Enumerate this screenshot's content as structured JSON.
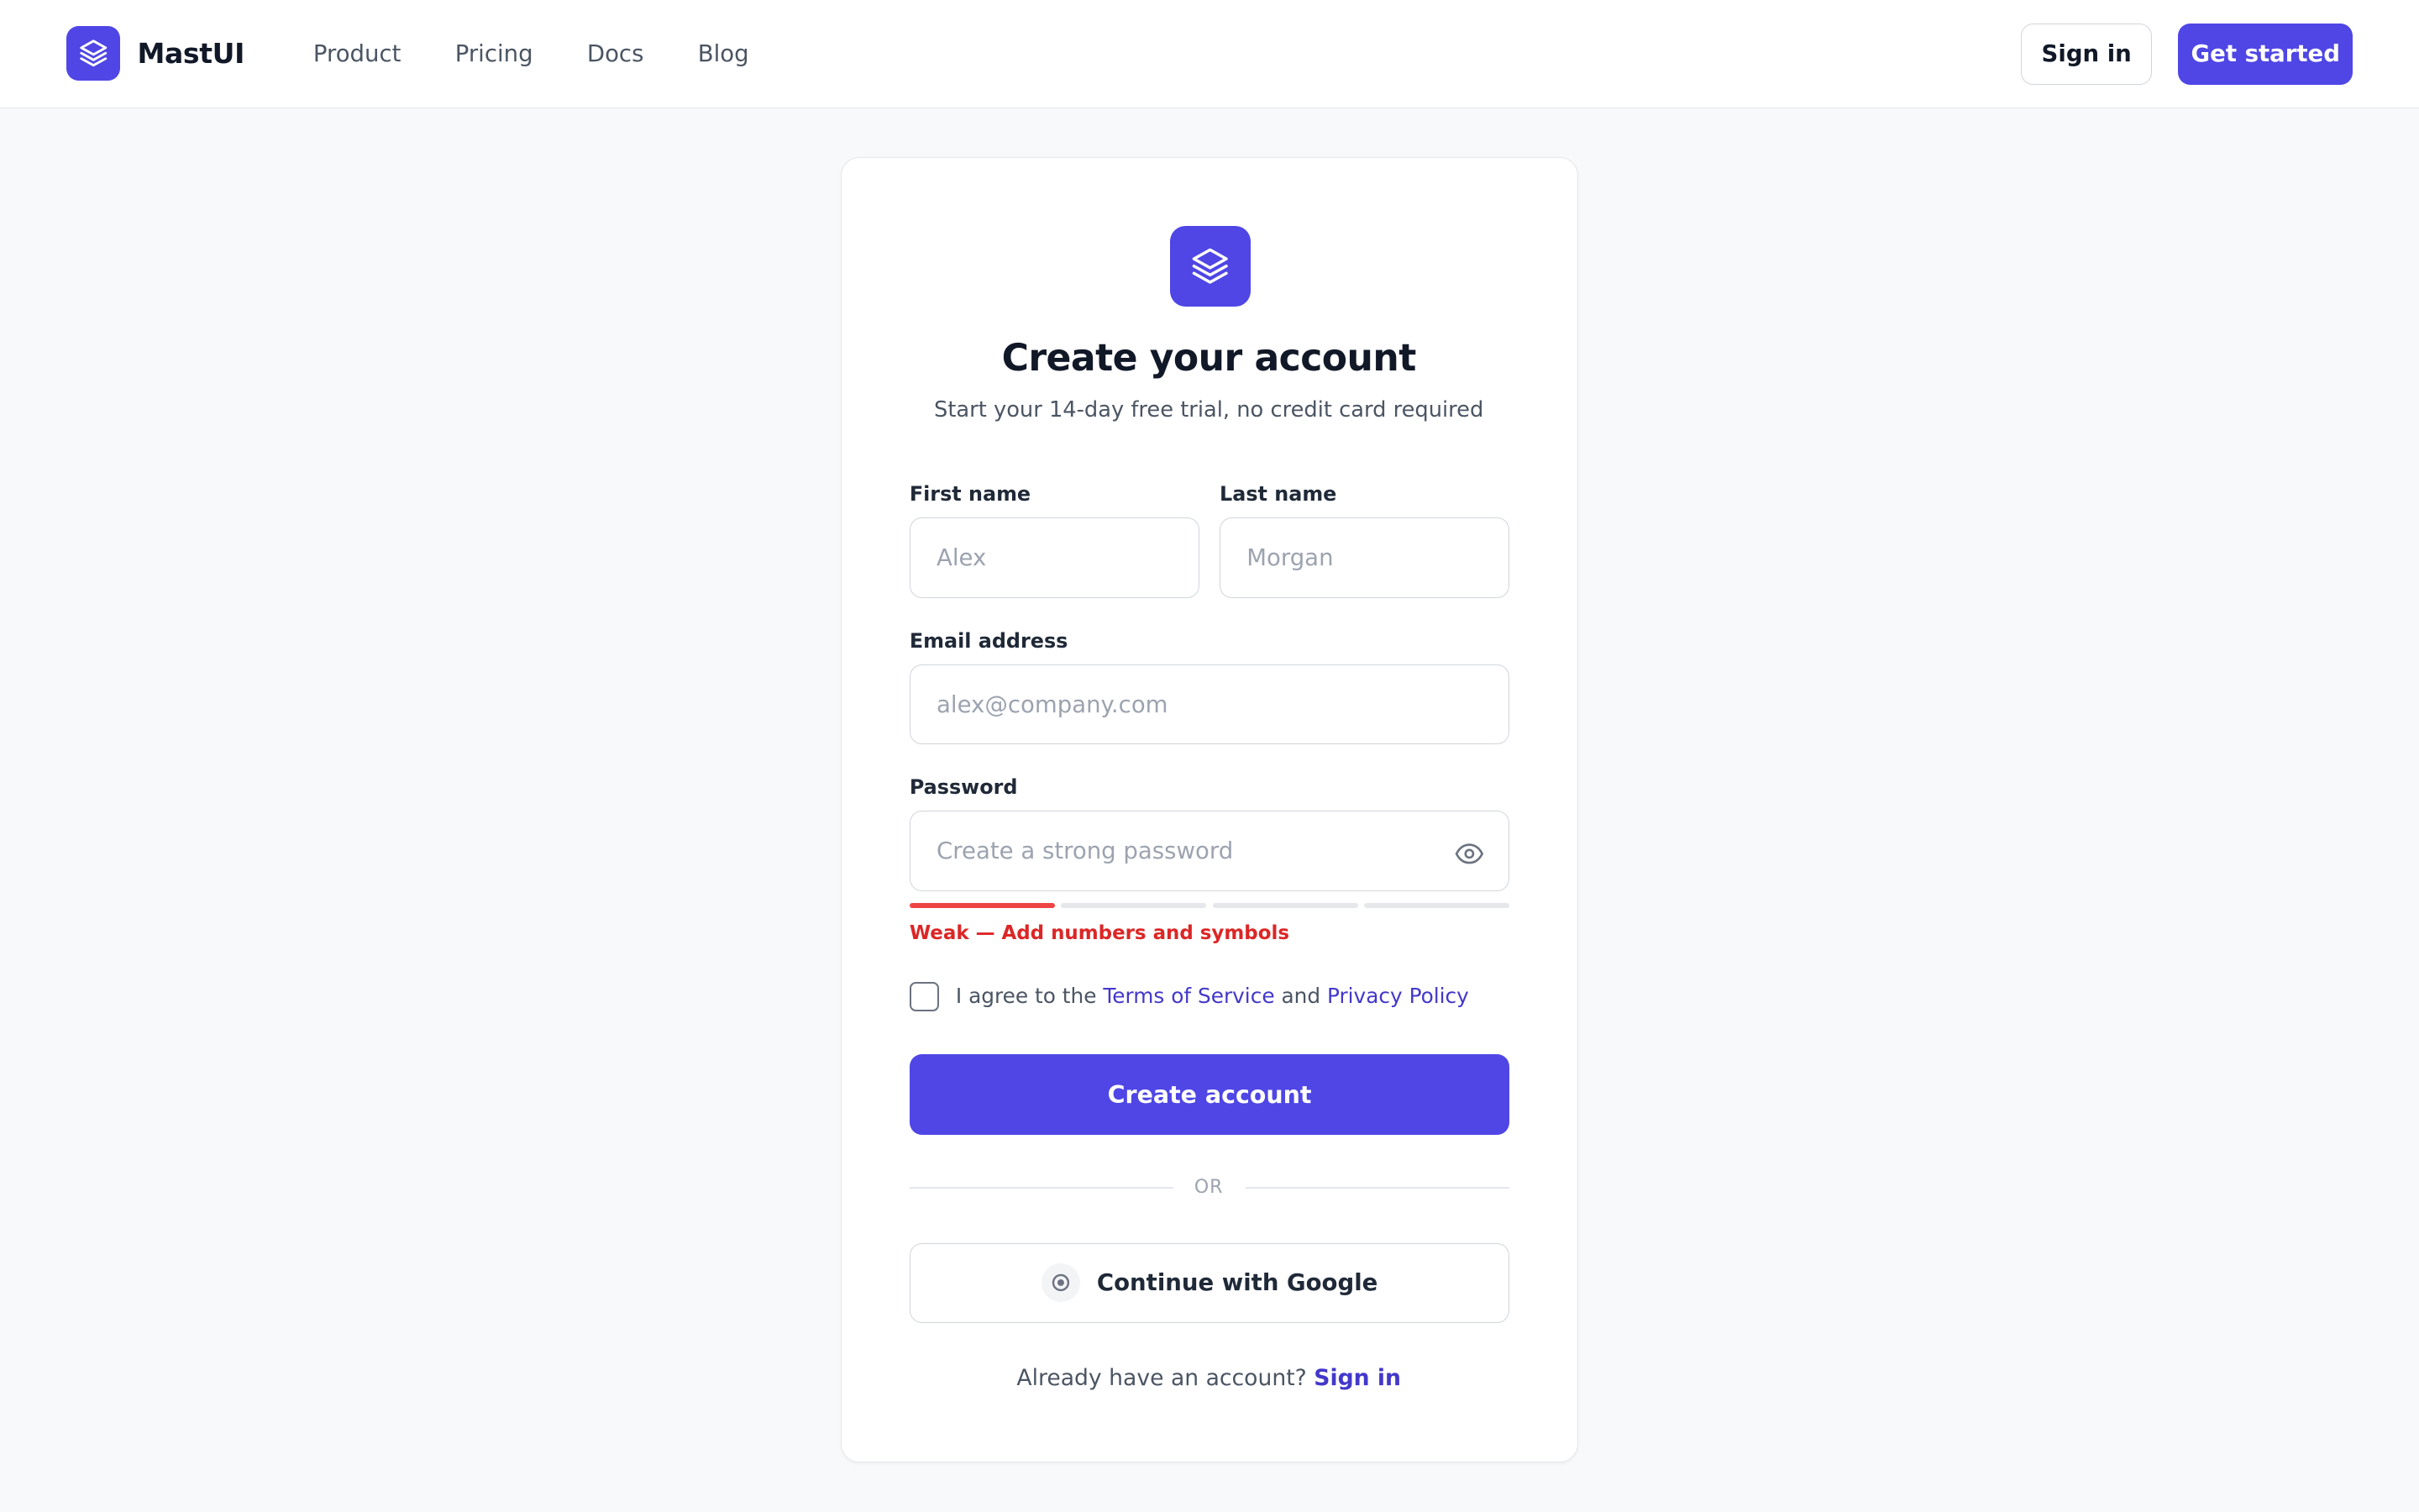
{
  "app": {
    "brand_name": "MastUI",
    "brand_icon": "layers-icon",
    "accent_color": "#4f46e5"
  },
  "nav": {
    "items": [
      {
        "label": "Product"
      },
      {
        "label": "Pricing"
      },
      {
        "label": "Docs"
      },
      {
        "label": "Blog"
      }
    ],
    "signin_label": "Sign in",
    "get_started_label": "Get started"
  },
  "form": {
    "icon": "layers-icon",
    "title": "Create your account",
    "subtitle": "Start your 14-day free trial, no credit card required",
    "first_name": {
      "label": "First name",
      "placeholder": "Alex",
      "value": ""
    },
    "last_name": {
      "label": "Last name",
      "placeholder": "Morgan",
      "value": ""
    },
    "email": {
      "label": "Email address",
      "placeholder": "alex@company.com",
      "value": ""
    },
    "password": {
      "label": "Password",
      "placeholder": "Create a strong password",
      "value": "",
      "toggle_icon": "eye-icon",
      "strength": {
        "level": 1,
        "max": 4,
        "color": "#ef4444",
        "text": "Weak — Add numbers and symbols"
      }
    },
    "terms": {
      "checked": false,
      "prefix": "I agree to the",
      "terms_link": "Terms of Service",
      "conjunction": "and",
      "privacy_link": "Privacy Policy"
    },
    "submit_label": "Create account",
    "divider_label": "OR",
    "google_label": "Continue with Google",
    "google_icon": "google-icon",
    "footer": {
      "prompt": "Already have an account?",
      "signin_link": "Sign in"
    }
  }
}
